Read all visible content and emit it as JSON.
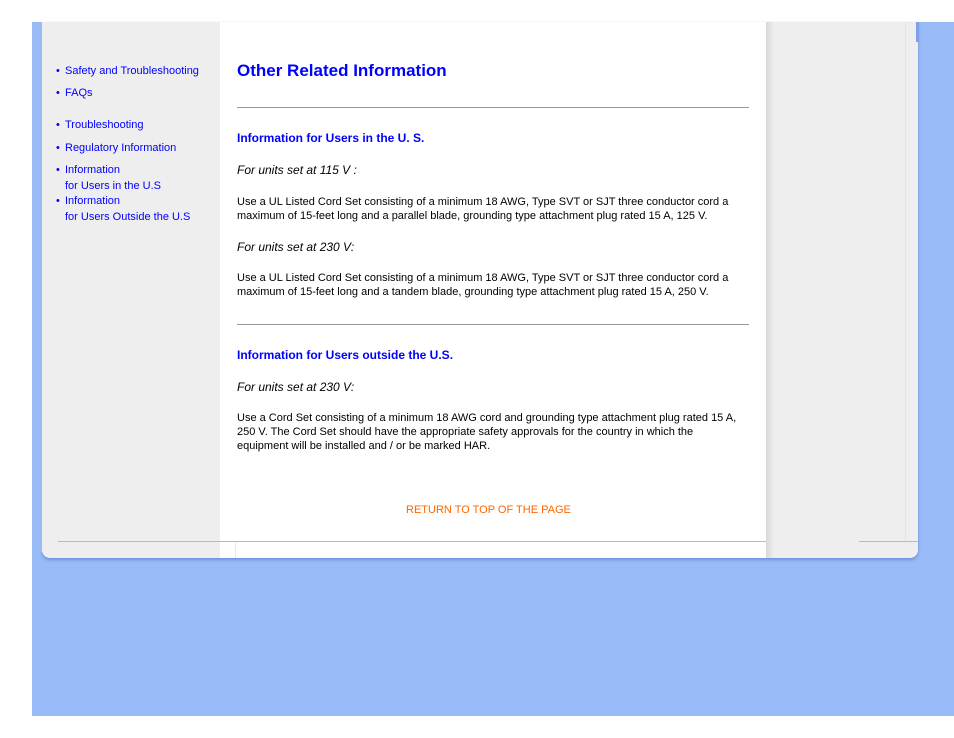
{
  "colors": {
    "background": "#99bbf7",
    "link": "#0000ff",
    "return_link": "#ff6600",
    "panel": "#eeeeee"
  },
  "sidebar": {
    "items": [
      {
        "label": "Safety and Troubleshooting"
      },
      {
        "label": "FAQs"
      },
      {
        "label": "Troubleshooting"
      },
      {
        "label": "Regulatory Information"
      },
      {
        "line1": "Information",
        "line2": "for Users in the U.S"
      },
      {
        "line1": "Information",
        "line2": "for Users Outside the U.S"
      }
    ]
  },
  "main": {
    "title": "Other Related Information",
    "sections": [
      {
        "heading": "Information for Users in the U. S.",
        "blocks": [
          {
            "subheading": "For units set at 115 V :",
            "text": "Use a UL Listed Cord Set consisting of a minimum 18 AWG, Type SVT or SJT three conductor cord a maximum of 15-feet long and a parallel blade, grounding type attachment plug rated 15 A, 125 V."
          },
          {
            "subheading": "For units set at 230 V:",
            "text": "Use a UL Listed Cord Set consisting of a minimum 18 AWG, Type SVT or SJT three conductor cord a maximum of 15-feet long and a tandem blade, grounding type attachment plug rated 15 A, 250 V."
          }
        ]
      },
      {
        "heading": "Information for Users outside the U.S.",
        "blocks": [
          {
            "subheading": "For units set at 230 V:",
            "text": "Use a Cord Set consisting of a minimum 18 AWG cord and grounding type attachment plug rated 15 A, 250 V. The Cord Set should have the appropriate safety approvals for the country in which the equipment will be installed and / or be marked HAR."
          }
        ]
      }
    ],
    "return_link": "RETURN TO TOP OF THE PAGE"
  }
}
